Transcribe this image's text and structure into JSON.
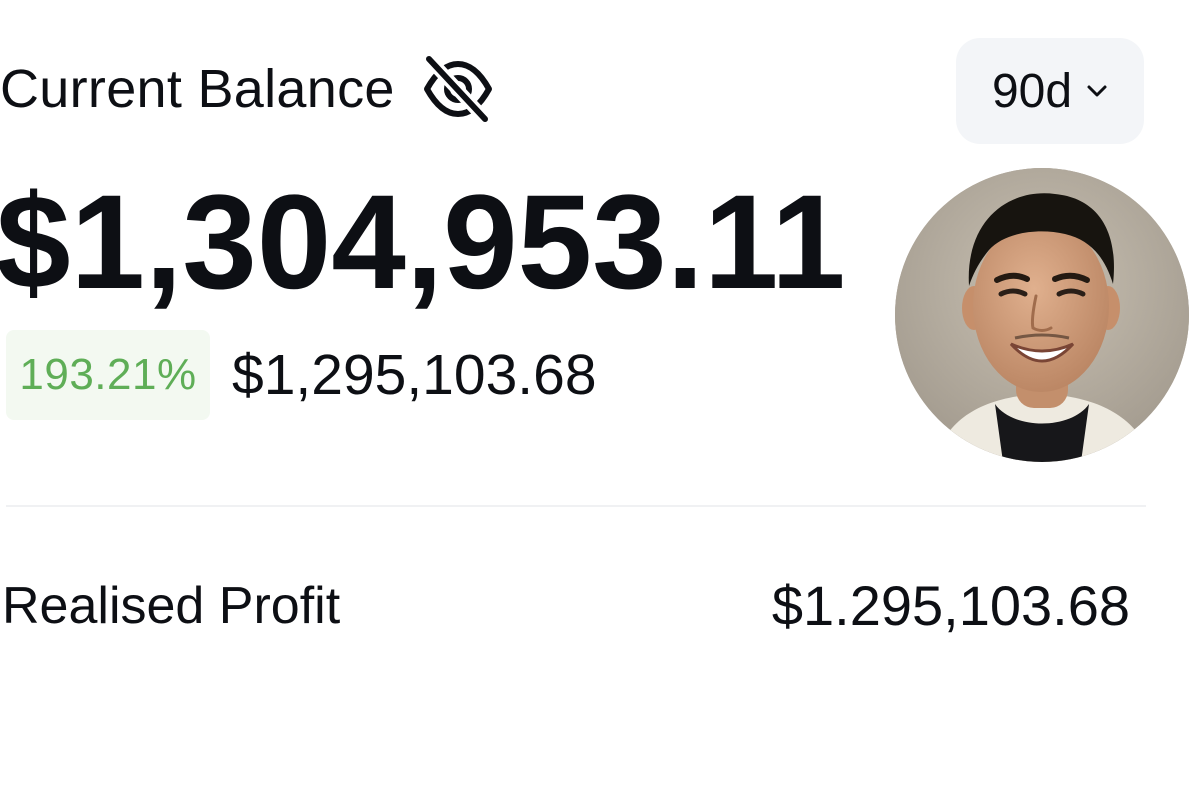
{
  "balance": {
    "label": "Current Balance",
    "amount": "$1,304,953.11",
    "change_percent": "193.21%",
    "change_amount": "$1,295,103.68",
    "visibility_icon": "eye-off-icon"
  },
  "period": {
    "selected": "90d",
    "icon": "chevron-down-icon"
  },
  "profit": {
    "label": "Realised Profit",
    "value": "$1.295,103.68"
  },
  "colors": {
    "positive": "#5fae57",
    "positive_bg": "#f3f9f1",
    "select_bg": "#f3f5f8",
    "text": "#0d0f14"
  }
}
